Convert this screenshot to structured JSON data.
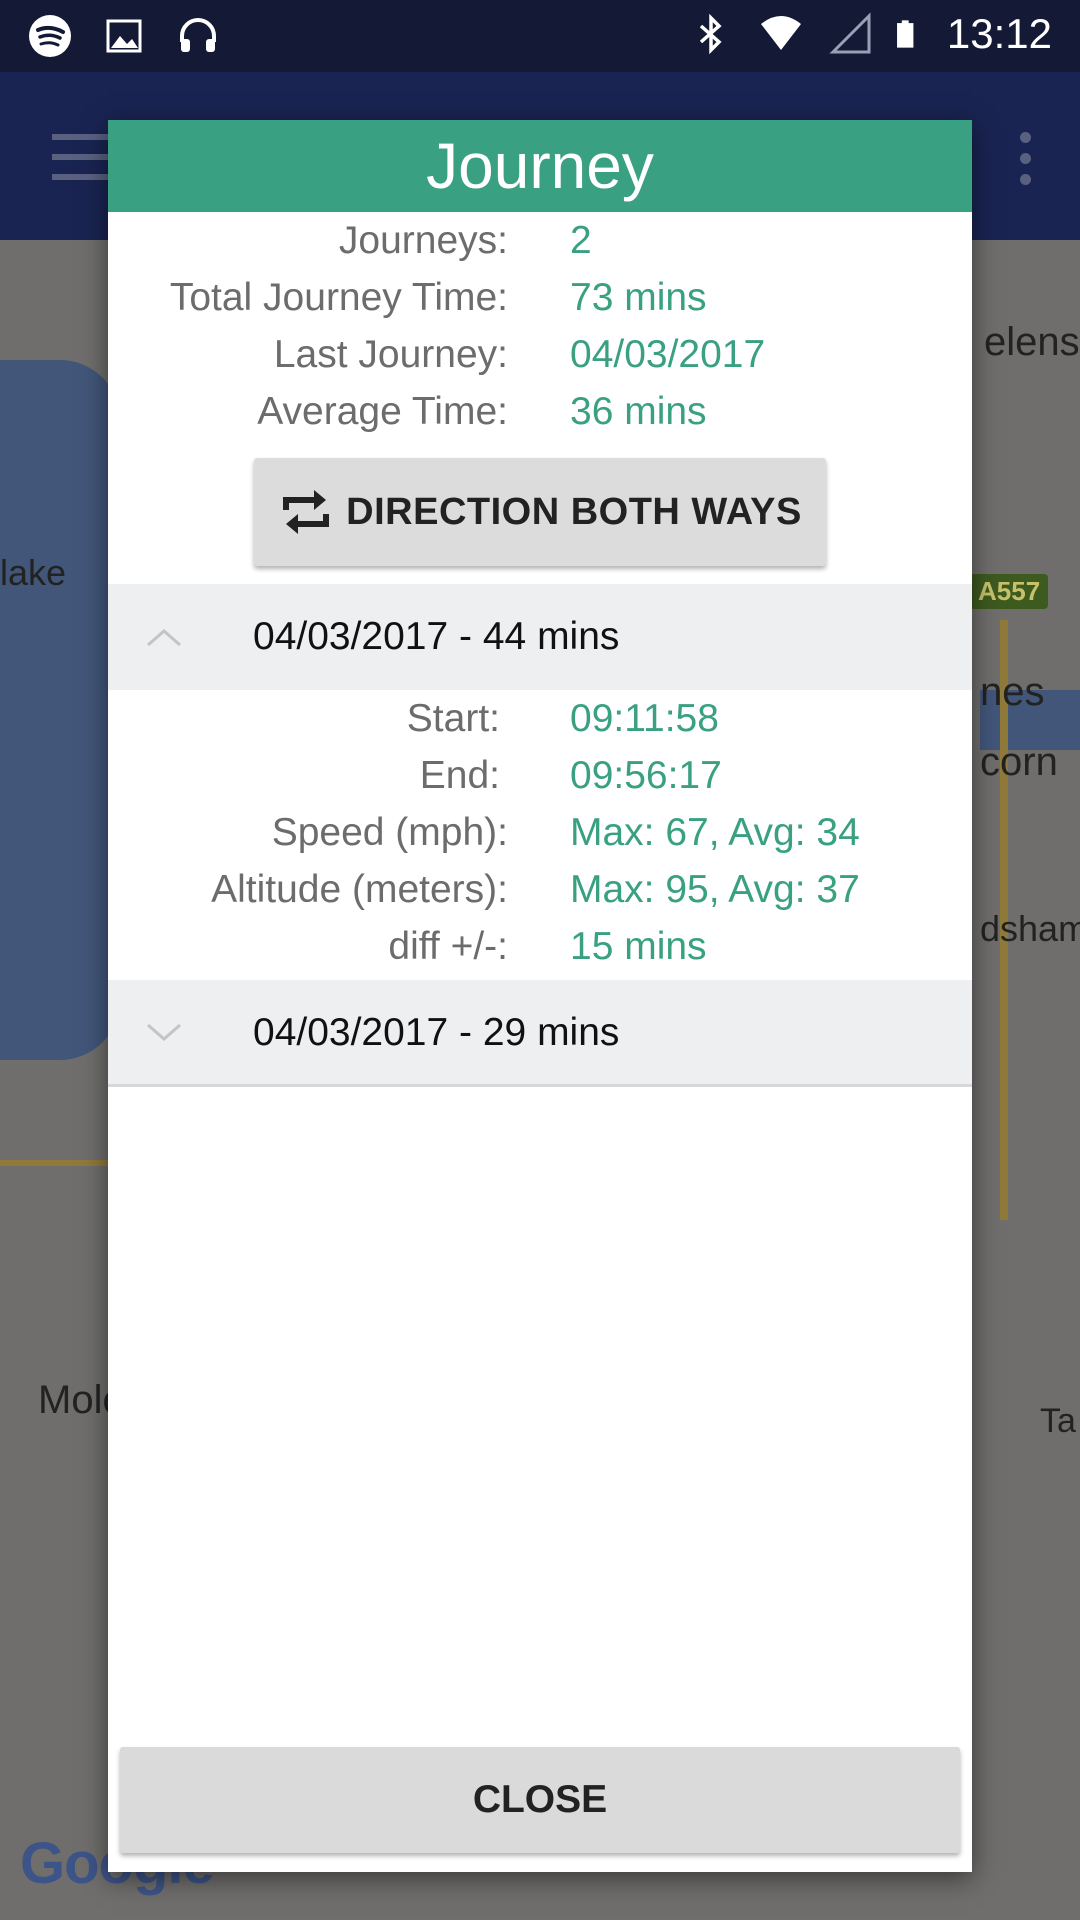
{
  "status_bar": {
    "time": "13:12",
    "left_icons": [
      "spotify-icon",
      "image-icon",
      "headset-icon"
    ],
    "right_icons": [
      "bluetooth-icon",
      "wifi-icon",
      "signal-icon",
      "battery-icon"
    ]
  },
  "map": {
    "labels": [
      "elens",
      "lake",
      "nes",
      "corn",
      "dsham",
      "Molc",
      "Ta"
    ],
    "road_badge": "A557",
    "google_logo": "Google"
  },
  "dialog": {
    "title": "Journey",
    "summary": [
      {
        "label": "Journeys:",
        "value": "2"
      },
      {
        "label": "Total Journey Time:",
        "value": "73 mins"
      },
      {
        "label": "Last Journey:",
        "value": "04/03/2017"
      },
      {
        "label": "Average Time:",
        "value": "36 mins"
      }
    ],
    "direction_button": {
      "label": "DIRECTION BOTH WAYS",
      "icon": "swap-icon"
    },
    "journeys": [
      {
        "header": "04/03/2017 - 44 mins",
        "expanded": true,
        "details": [
          {
            "label": "Start:",
            "value": "09:11:58"
          },
          {
            "label": "End:",
            "value": "09:56:17"
          },
          {
            "label": "Speed (mph):",
            "value": "Max: 67, Avg: 34"
          },
          {
            "label": "Altitude (meters):",
            "value": "Max: 95, Avg: 37"
          },
          {
            "label": "diff +/-:",
            "value": "15 mins"
          }
        ]
      },
      {
        "header": "04/03/2017 - 29 mins",
        "expanded": false
      }
    ],
    "close_label": "CLOSE"
  },
  "colors": {
    "accent": "#3aa082",
    "status_bar": "#141a35",
    "app_bar": "#1a2452",
    "group_bg": "#eeeff1",
    "button_bg": "#dadada"
  }
}
